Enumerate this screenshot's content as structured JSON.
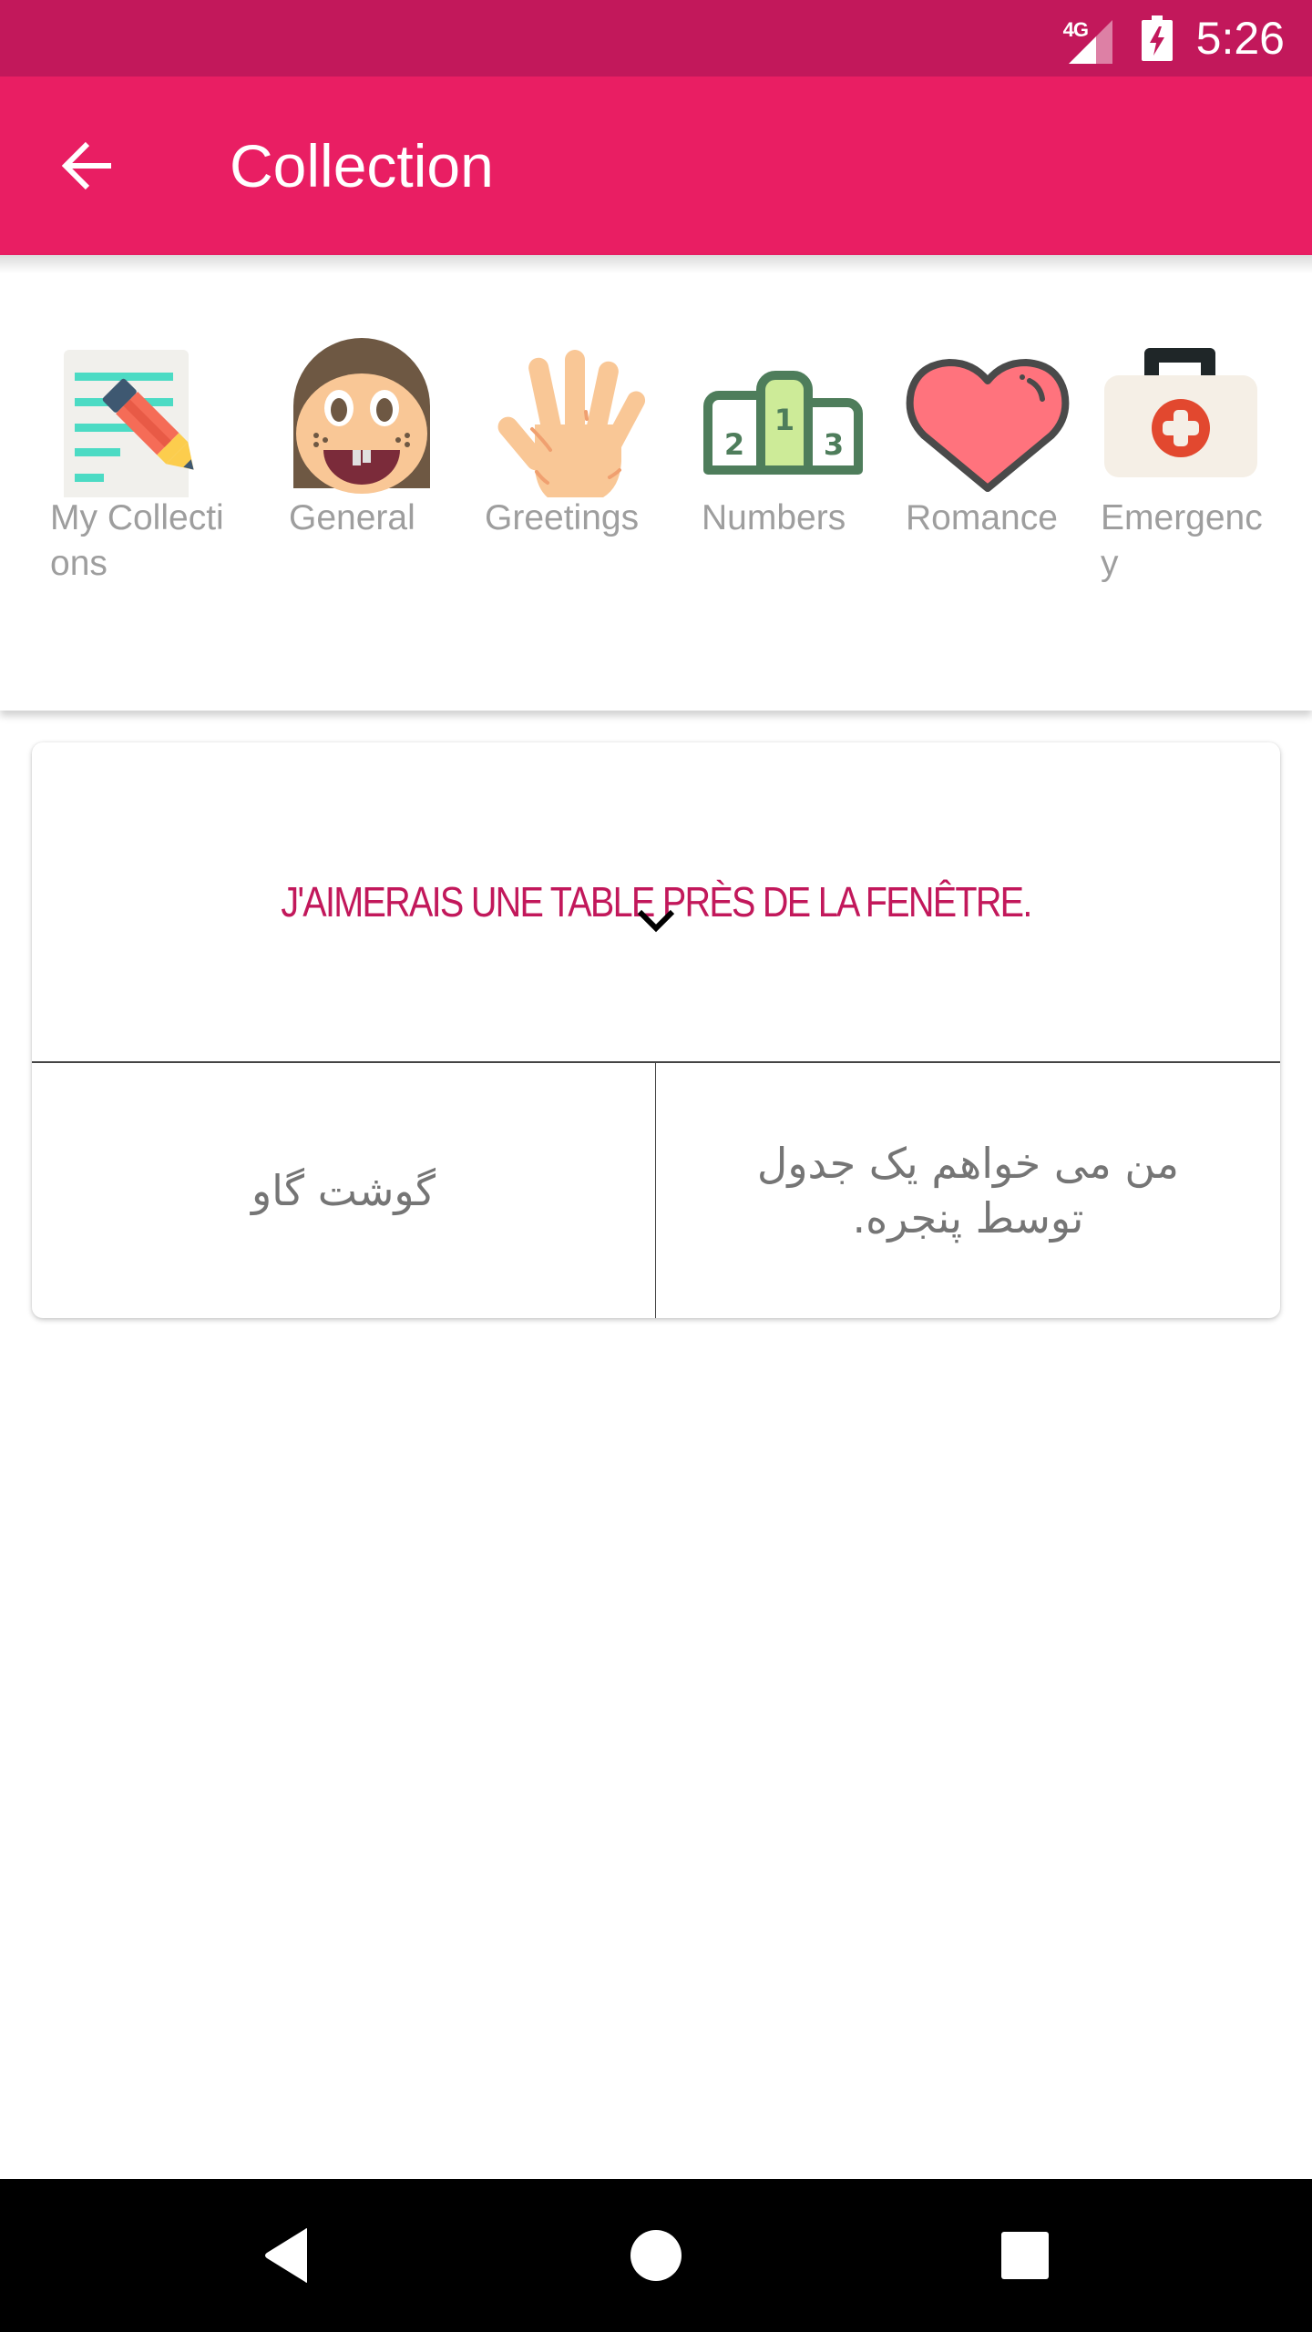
{
  "status_bar": {
    "network_label": "4G",
    "time": "5:26",
    "icons": [
      "signal-icon",
      "battery-charging-icon"
    ]
  },
  "app_bar": {
    "back_icon": "arrow-back-icon",
    "title": "Collection"
  },
  "categories": {
    "items": [
      {
        "label": "My Collections",
        "icon": "notes-pencil-icon"
      },
      {
        "label": "General",
        "icon": "smiling-face-icon"
      },
      {
        "label": "Greetings",
        "icon": "waving-hand-icon"
      },
      {
        "label": "Numbers",
        "icon": "podium-icon"
      },
      {
        "label": "Romance",
        "icon": "heart-icon"
      },
      {
        "label": "Emergency",
        "icon": "first-aid-kit-icon"
      }
    ],
    "expand_icon": "chevron-down-icon"
  },
  "phrase_card": {
    "phrase": "J'AIMERAIS UNE TABLE PRÈS DE LA FENÊTRE.",
    "left_translation": "گوشت گاو",
    "right_translation": "من می خواهم یک جدول توسط پنجره."
  },
  "nav_bar": {
    "buttons": [
      "back-triangle-icon",
      "home-circle-icon",
      "recents-square-icon"
    ]
  },
  "colors": {
    "status_bar": "#C2185B",
    "app_bar": "#E91E63",
    "phrase_text": "#C2185B",
    "category_label": "#9E9E9E",
    "translation_text": "#757575"
  }
}
